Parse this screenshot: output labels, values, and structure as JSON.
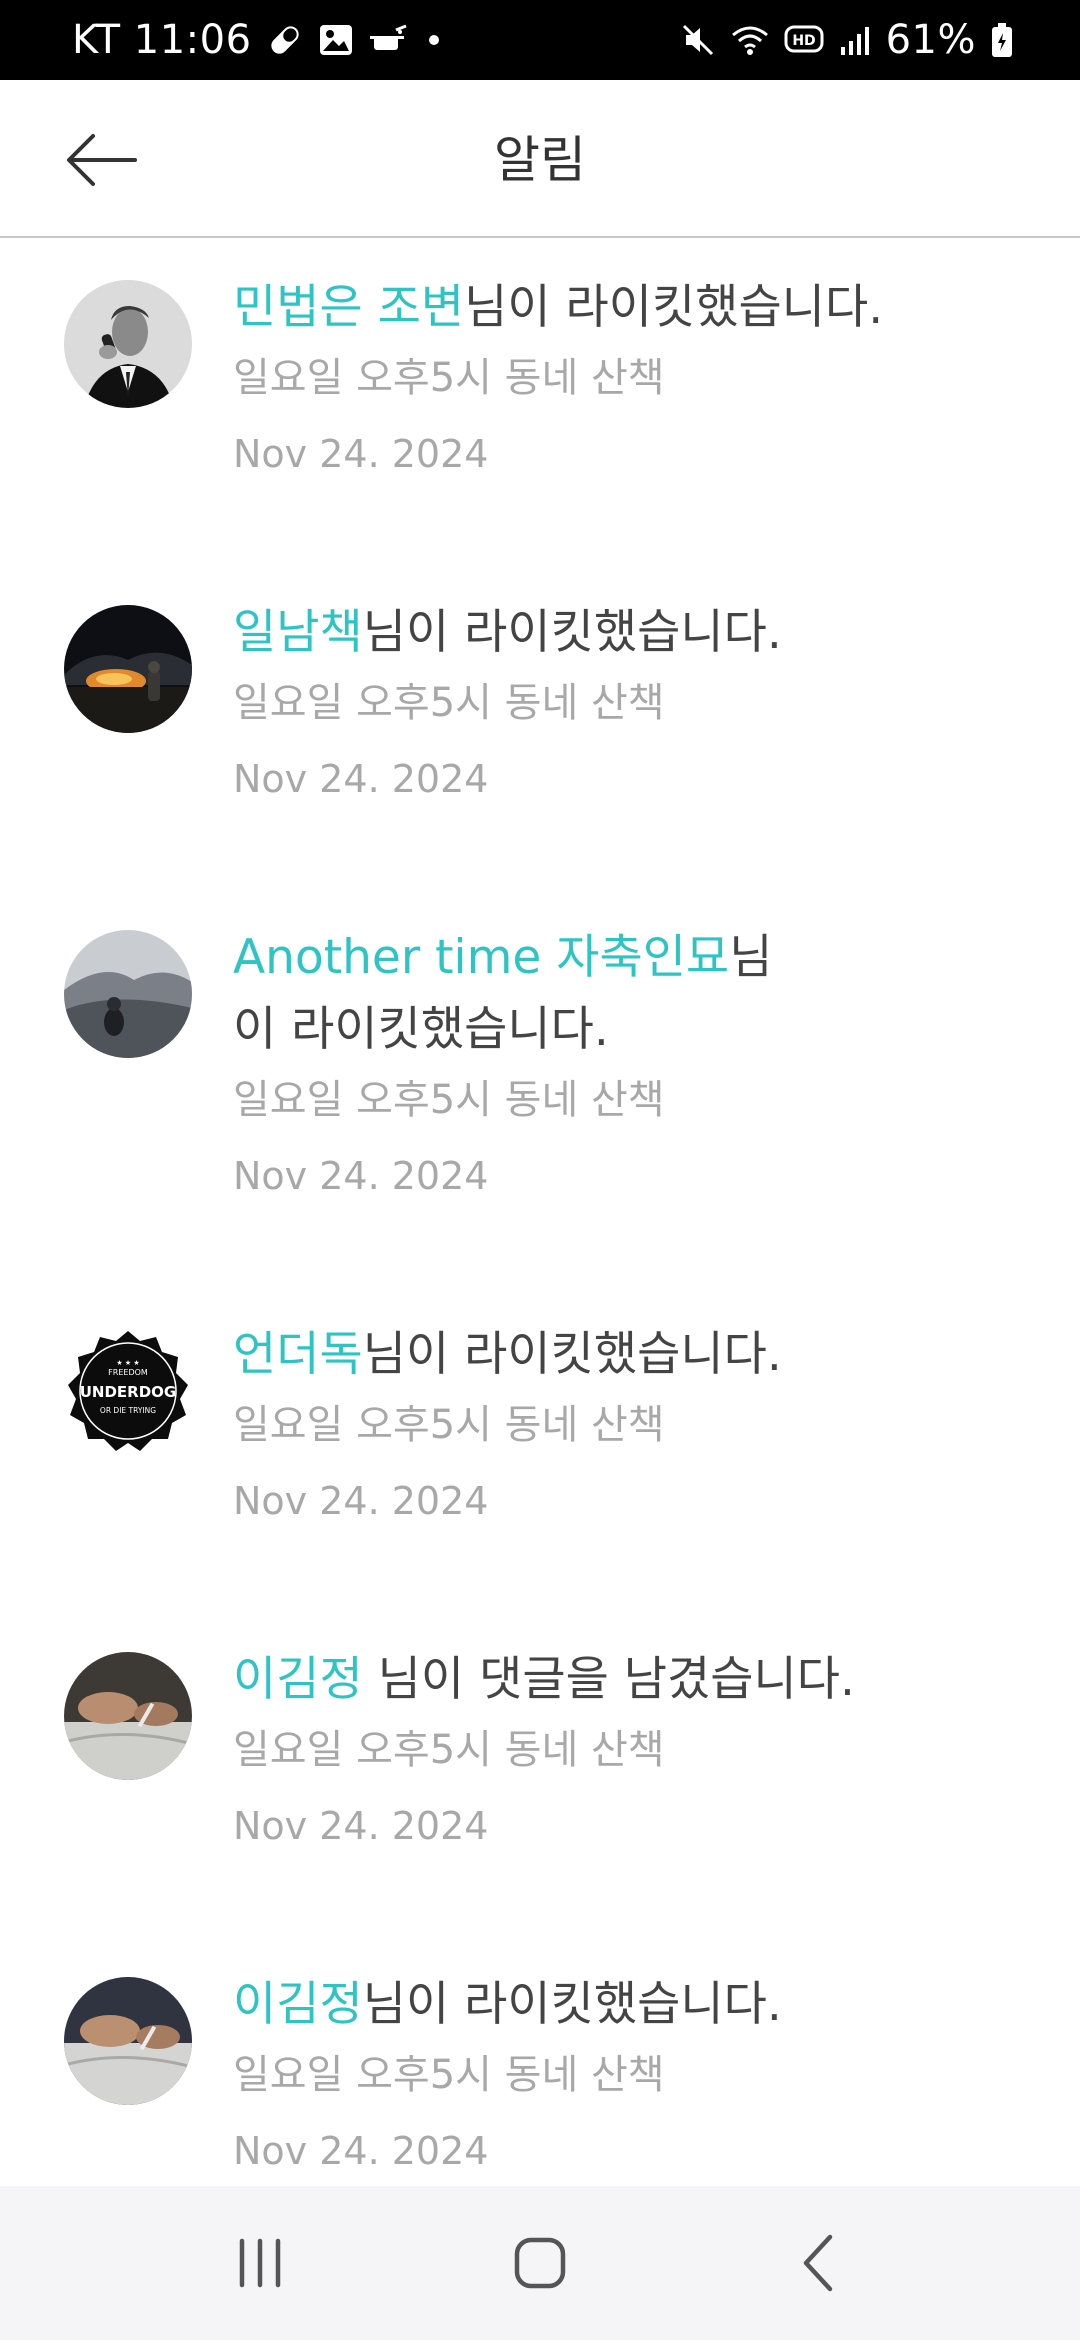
{
  "status_bar": {
    "carrier_time": "KT 11:06",
    "battery": "61%",
    "icons": [
      "pill-icon",
      "image-icon",
      "pot-icon",
      "dot-icon",
      "mute-icon",
      "wifi-icon",
      "hd-icon",
      "signal-icon",
      "battery-icon"
    ]
  },
  "header": {
    "title": "알림",
    "back_icon": "arrow-left-icon"
  },
  "colors": {
    "accent": "#2ec4c4",
    "text": "#444444",
    "muted": "#a8a8a8"
  },
  "notifications": [
    {
      "name": "민법은 조변",
      "action": "님이 라이킷했습니다.",
      "subtitle": "일요일 오후5시 동네 산책",
      "date": "Nov 24. 2024"
    },
    {
      "name": "일남책",
      "action": "님이 라이킷했습니다.",
      "subtitle": "일요일 오후5시 동네 산책",
      "date": "Nov 24. 2024"
    },
    {
      "name": "Another time 자축인묘",
      "action": "님이 라이킷했습니다.",
      "subtitle": "일요일 오후5시 동네 산책",
      "date": "Nov 24. 2024"
    },
    {
      "name": "언더독",
      "action": "님이 라이킷했습니다.",
      "subtitle": "일요일 오후5시 동네 산책",
      "date": "Nov 24. 2024",
      "avatar_text": {
        "top": "FREEDOM",
        "middle": "UNDERDOG",
        "bottom": "OR DIE TRYING"
      }
    },
    {
      "name": "이김정",
      "action": " 님이 댓글을 남겼습니다.",
      "subtitle": "일요일 오후5시 동네 산책",
      "date": "Nov 24. 2024"
    },
    {
      "name": "이김정",
      "action": "님이 라이킷했습니다.",
      "subtitle": "일요일 오후5시 동네 산책",
      "date": "Nov 24. 2024"
    }
  ],
  "nav_bar": {
    "icons": [
      "recent-apps-icon",
      "home-icon",
      "back-icon"
    ]
  }
}
